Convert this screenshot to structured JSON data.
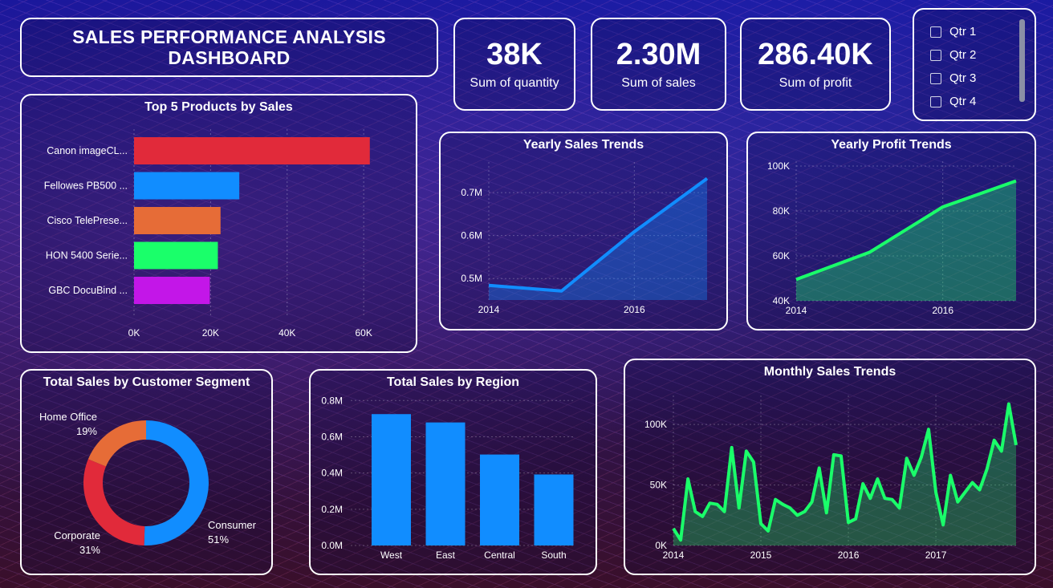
{
  "dashboard": {
    "title_line1": "SALES PERFORMANCE ANALYSIS",
    "title_line2": "DASHBOARD"
  },
  "kpis": [
    {
      "value": "38K",
      "label": "Sum of quantity"
    },
    {
      "value": "2.30M",
      "label": "Sum of sales"
    },
    {
      "value": "286.40K",
      "label": "Sum of profit"
    }
  ],
  "slicer": {
    "items": [
      "Qtr 1",
      "Qtr 2",
      "Qtr 3",
      "Qtr 4"
    ]
  },
  "colors": {
    "border": "#ffffff",
    "blue": "#118dff",
    "green": "#1aff6a",
    "red": "#e12a3a",
    "orange": "#e66c37",
    "magenta": "#c316e8"
  },
  "chart_data": [
    {
      "id": "top5",
      "type": "bar",
      "orientation": "horizontal",
      "title": "Top 5 Products by Sales",
      "categories": [
        "Canon imageCL...",
        "Fellowes PB500 ...",
        "Cisco TelePrese...",
        "HON 5400 Serie...",
        "GBC DocuBind ..."
      ],
      "values": [
        61600,
        27500,
        22600,
        21900,
        19800
      ],
      "colors": [
        "#e12a3a",
        "#118dff",
        "#e66c37",
        "#1aff6a",
        "#c316e8"
      ],
      "xlim": [
        0,
        65000
      ],
      "xticks": [
        "0K",
        "20K",
        "40K",
        "60K"
      ],
      "grid": true
    },
    {
      "id": "yearly_sales",
      "type": "area",
      "title": "Yearly Sales Trends",
      "x": [
        2014,
        2015,
        2016,
        2017
      ],
      "values": [
        484000,
        471000,
        609000,
        733000
      ],
      "ylim": [
        450000,
        760000
      ],
      "yticks": [
        "0.5M",
        "0.6M",
        "0.7M"
      ],
      "xticks": [
        "2014",
        "2016"
      ],
      "color": "#118dff",
      "grid": true
    },
    {
      "id": "yearly_profit",
      "type": "area",
      "title": "Yearly Profit Trends",
      "x": [
        2014,
        2015,
        2016,
        2017
      ],
      "values": [
        49500,
        61600,
        81800,
        93400
      ],
      "ylim": [
        40000,
        100000
      ],
      "yticks": [
        "40K",
        "60K",
        "80K",
        "100K"
      ],
      "xticks": [
        "2014",
        "2016"
      ],
      "color": "#1aff6a",
      "grid": true
    },
    {
      "id": "segment",
      "type": "pie",
      "title": "Total Sales by Customer Segment",
      "categories": [
        "Consumer",
        "Corporate",
        "Home Office"
      ],
      "values": [
        51,
        31,
        19
      ],
      "percent_labels": [
        "51%",
        "31%",
        "19%"
      ],
      "colors": [
        "#118dff",
        "#e12a3a",
        "#e66c37"
      ],
      "donut": true
    },
    {
      "id": "region",
      "type": "bar",
      "title": "Total Sales by Region",
      "categories": [
        "West",
        "East",
        "Central",
        "South"
      ],
      "values": [
        725000,
        679000,
        502000,
        392000
      ],
      "ylim": [
        0,
        850000
      ],
      "yticks": [
        "0.0M",
        "0.2M",
        "0.4M",
        "0.6M",
        "0.8M"
      ],
      "color": "#118dff",
      "grid": true
    },
    {
      "id": "monthly",
      "type": "area",
      "title": "Monthly Sales Trends",
      "x": [
        "2014-01",
        "2014-02",
        "2014-03",
        "2014-04",
        "2014-05",
        "2014-06",
        "2014-07",
        "2014-08",
        "2014-09",
        "2014-10",
        "2014-11",
        "2014-12",
        "2015-01",
        "2015-02",
        "2015-03",
        "2015-04",
        "2015-05",
        "2015-06",
        "2015-07",
        "2015-08",
        "2015-09",
        "2015-10",
        "2015-11",
        "2015-12",
        "2016-01",
        "2016-02",
        "2016-03",
        "2016-04",
        "2016-05",
        "2016-06",
        "2016-07",
        "2016-08",
        "2016-09",
        "2016-10",
        "2016-11",
        "2016-12",
        "2017-01",
        "2017-02",
        "2017-03",
        "2017-04",
        "2017-05",
        "2017-06",
        "2017-07",
        "2017-08",
        "2017-09",
        "2017-10",
        "2017-11",
        "2017-12"
      ],
      "values": [
        14000,
        4500,
        55000,
        28000,
        24000,
        35000,
        34000,
        28000,
        81000,
        31000,
        78000,
        69000,
        18000,
        12000,
        38000,
        34000,
        31000,
        25000,
        28000,
        36000,
        64000,
        27000,
        75000,
        74000,
        19000,
        22000,
        51000,
        39000,
        55000,
        39000,
        38000,
        31000,
        72000,
        58000,
        73000,
        96000,
        44000,
        17000,
        58000,
        36000,
        44000,
        52000,
        46000,
        63000,
        87000,
        78000,
        117000,
        83000
      ],
      "ylim": [
        0,
        120000
      ],
      "yticks": [
        "0K",
        "50K",
        "100K"
      ],
      "xticks": [
        "2014",
        "2015",
        "2016",
        "2017"
      ],
      "color": "#1aff6a",
      "grid": true
    }
  ]
}
